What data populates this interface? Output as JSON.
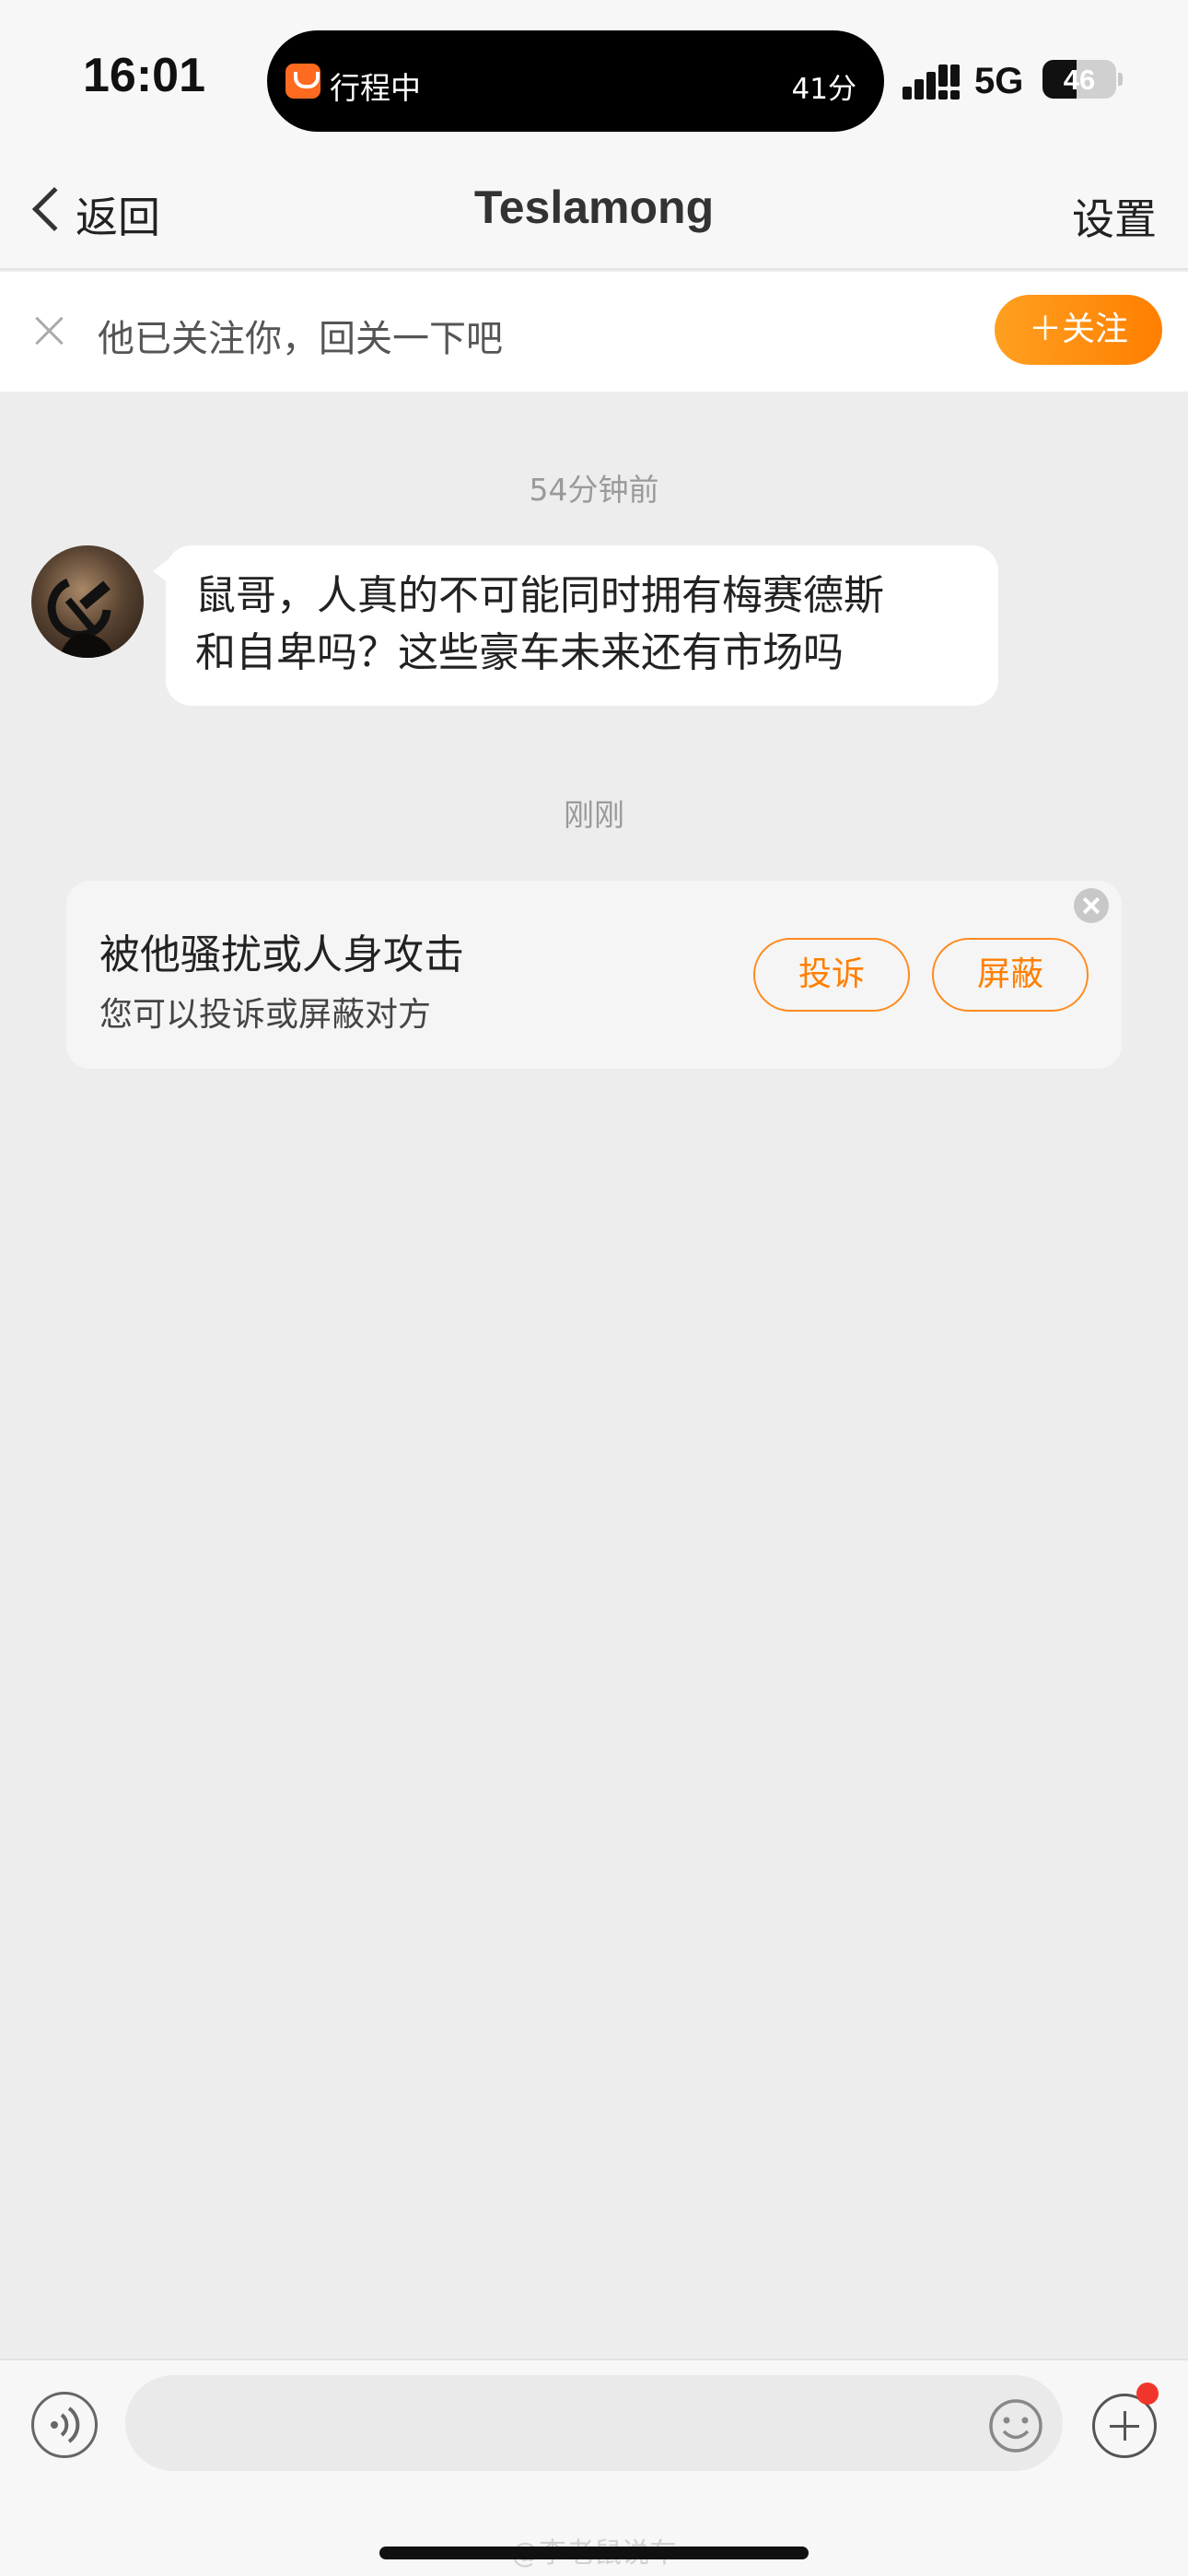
{
  "status_bar": {
    "time": "16:01",
    "island_app_icon": "didi-icon",
    "island_label": "行程中",
    "island_eta": "41分",
    "signal_icon": "cellular-signal-icon",
    "network": "5G",
    "battery_level": "46",
    "battery_fraction": 0.46
  },
  "nav": {
    "back_label": "返回",
    "title": "Teslamong",
    "settings_label": "设置"
  },
  "follow_banner": {
    "text": "他已关注你，回关一下吧",
    "follow_button": "＋关注"
  },
  "chat": {
    "messages": [
      {
        "timestamp": "54分钟前",
        "line1": "鼠哥，人真的不可能同时拥有梅赛德斯",
        "line2": "和自卑吗？这些豪车未来还有市场吗"
      }
    ],
    "second_timestamp": "刚刚"
  },
  "report_card": {
    "title": "被他骚扰或人身攻击",
    "subtitle": "您可以投诉或屏蔽对方",
    "report_button": "投诉",
    "block_button": "屏蔽"
  },
  "input_bar": {
    "voice_icon": "voice-input-icon",
    "emoji_icon": "emoji-icon",
    "plus_icon": "plus-icon",
    "placeholder": ""
  },
  "watermark": "@李老鼠说车",
  "colors": {
    "accent": "#ff8a1e",
    "background": "#ededed",
    "notification_dot": "#f0362c"
  }
}
